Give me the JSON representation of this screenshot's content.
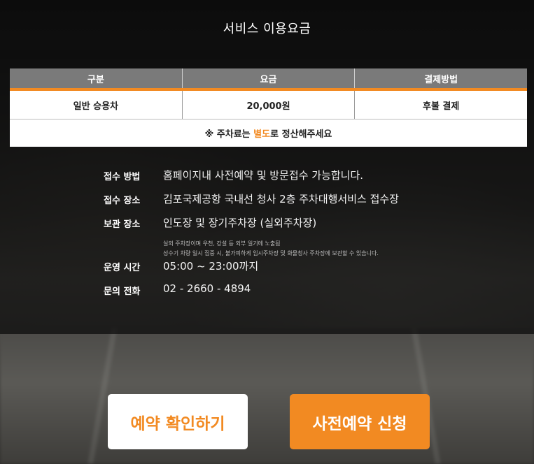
{
  "page": {
    "title": "서비스 이용요금"
  },
  "fee_table": {
    "headers": [
      "구분",
      "요금",
      "결제방법"
    ],
    "rows": [
      [
        "일반 승용차",
        "20,000원",
        "후불 결제"
      ]
    ],
    "notice_prefix": "※ 주차료는 ",
    "notice_highlight": "별도",
    "notice_suffix": "로 정산해주세요",
    "accent_color": "#f28a22"
  },
  "info": [
    {
      "label": "접수 방법",
      "value": "홈페이지내 사전예약 및 방문접수 가능합니다."
    },
    {
      "label": "접수 장소",
      "value": "김포국제공항 국내선 청사 2층 주차대행서비스 접수장"
    },
    {
      "label": "보관 장소",
      "value": "인도장 및 장기주차장 (실외주차장)"
    },
    {
      "label": "운영 시간",
      "value": "05:00 ~ 23:00까지"
    },
    {
      "label": "문의 전화",
      "value": "02 - 2660 - 4894"
    }
  ],
  "storage_notes": [
    "실외 주차장이며 우천, 강설 등 외부 일기에 노출됨",
    "성수기 차량 일시 집중 시, 불가피하게 임시주차장 및 화물청사 주차장에 보관할 수 있습니다."
  ],
  "buttons": {
    "confirm_label": "예약 확인하기",
    "reserve_label": "사전예약 신청"
  }
}
